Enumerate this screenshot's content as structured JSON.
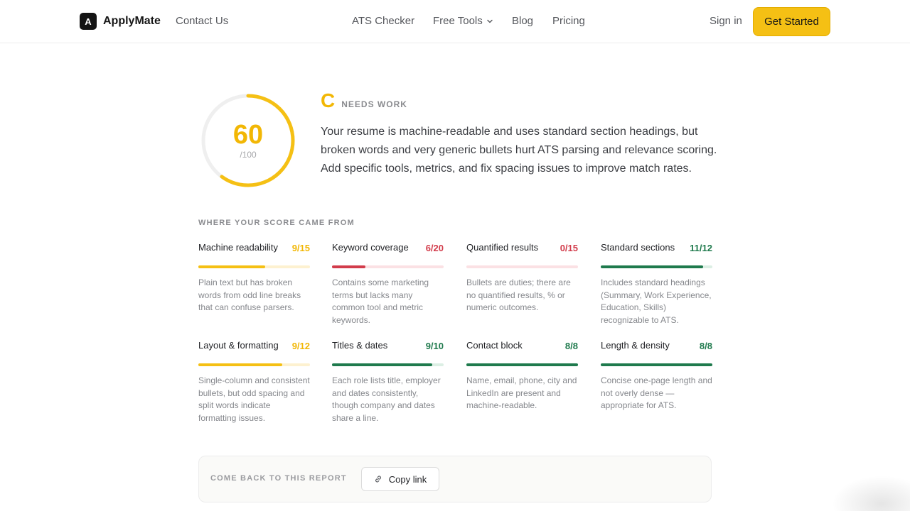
{
  "nav": {
    "brand_mark": "A",
    "brand_name": "ApplyMate",
    "contact": "Contact Us",
    "ats_checker": "ATS Checker",
    "free_tools": "Free Tools",
    "blog": "Blog",
    "pricing": "Pricing",
    "sign_in": "Sign in",
    "get_started": "Get Started"
  },
  "score": {
    "value": "60",
    "max": "/100",
    "fraction": 0.6,
    "grade": "C",
    "grade_label": "NEEDS WORK",
    "summary": "Your resume is machine-readable and uses standard section headings, but broken words and very generic bullets hurt ATS parsing and relevance scoring. Add specific tools, metrics, and fix spacing issues to improve match rates."
  },
  "breakdown": {
    "title": "WHERE YOUR SCORE CAME FROM",
    "items": [
      {
        "label": "Machine readability",
        "score": "9/15",
        "fraction": 0.6,
        "status": "warn",
        "desc": "Plain text but has broken words from odd line breaks that can confuse parsers."
      },
      {
        "label": "Keyword coverage",
        "score": "6/20",
        "fraction": 0.3,
        "status": "bad",
        "desc": "Contains some marketing terms but lacks many common tool and metric keywords."
      },
      {
        "label": "Quantified results",
        "score": "0/15",
        "fraction": 0.0,
        "status": "bad",
        "desc": "Bullets are duties; there are no quantified results, % or numeric outcomes."
      },
      {
        "label": "Standard sections",
        "score": "11/12",
        "fraction": 0.917,
        "status": "good",
        "desc": "Includes standard headings (Summary, Work Experience, Education, Skills) recognizable to ATS."
      },
      {
        "label": "Layout & formatting",
        "score": "9/12",
        "fraction": 0.75,
        "status": "warn",
        "desc": "Single-column and consistent bullets, but odd spacing and split words indicate formatting issues."
      },
      {
        "label": "Titles & dates",
        "score": "9/10",
        "fraction": 0.9,
        "status": "good",
        "desc": "Each role lists title, employer and dates consistently, though company and dates share a line."
      },
      {
        "label": "Contact block",
        "score": "8/8",
        "fraction": 1.0,
        "status": "good",
        "desc": "Name, email, phone, city and LinkedIn are present and machine-readable."
      },
      {
        "label": "Length & density",
        "score": "8/8",
        "fraction": 1.0,
        "status": "good",
        "desc": "Concise one-page length and not overly dense — appropriate for ATS."
      }
    ]
  },
  "footer": {
    "label": "COME BACK TO THIS REPORT",
    "copy_link": "Copy link"
  },
  "colors": {
    "accent": "#f5c014",
    "warn": "#f2b705",
    "warn_track": "#fdf1d0",
    "bad": "#d23c4b",
    "bad_track": "#fbe1e4",
    "good": "#1f7a4d",
    "good_track": "#dcefe4",
    "ring_track": "#efefef"
  },
  "icons": [
    "chevron-down-icon",
    "link-icon"
  ]
}
